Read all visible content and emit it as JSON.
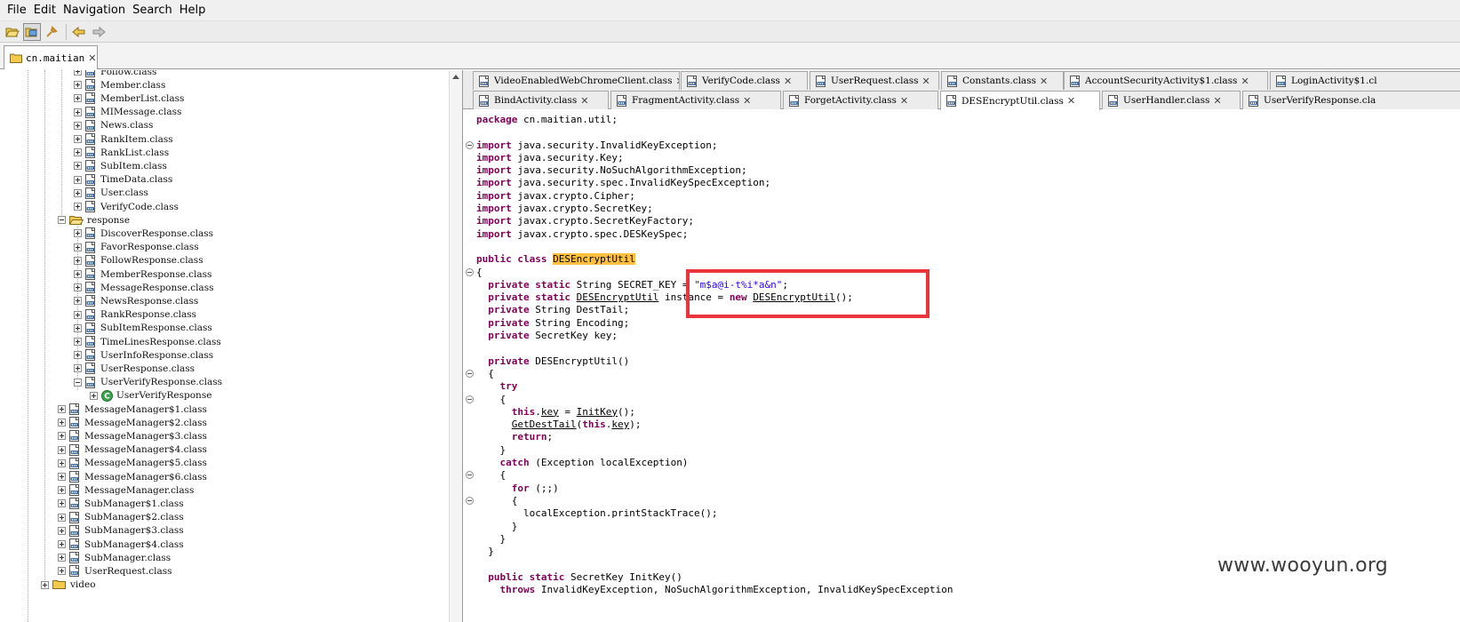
{
  "menu": {
    "items": [
      "File",
      "Edit",
      "Navigation",
      "Search",
      "Help"
    ]
  },
  "toolbar": {
    "buttons": [
      "open-file-icon",
      "open-project-icon",
      "sync-icon",
      "back-icon",
      "forward-icon"
    ]
  },
  "project_tab": {
    "label": "cn.maitian",
    "close": "✕"
  },
  "tree": {
    "rows": [
      {
        "label": "Follow.class",
        "kind": "class"
      },
      {
        "label": "Member.class",
        "kind": "class"
      },
      {
        "label": "MemberList.class",
        "kind": "class"
      },
      {
        "label": "MIMessage.class",
        "kind": "class"
      },
      {
        "label": "News.class",
        "kind": "class"
      },
      {
        "label": "RankItem.class",
        "kind": "class"
      },
      {
        "label": "RankList.class",
        "kind": "class"
      },
      {
        "label": "SubItem.class",
        "kind": "class"
      },
      {
        "label": "TimeData.class",
        "kind": "class"
      },
      {
        "label": "User.class",
        "kind": "class"
      },
      {
        "label": "VerifyCode.class",
        "kind": "class"
      },
      {
        "label": "response",
        "kind": "folder-open"
      },
      {
        "label": "DiscoverResponse.class",
        "kind": "class"
      },
      {
        "label": "FavorResponse.class",
        "kind": "class"
      },
      {
        "label": "FollowResponse.class",
        "kind": "class"
      },
      {
        "label": "MemberResponse.class",
        "kind": "class"
      },
      {
        "label": "MessageResponse.class",
        "kind": "class"
      },
      {
        "label": "NewsResponse.class",
        "kind": "class"
      },
      {
        "label": "RankResponse.class",
        "kind": "class"
      },
      {
        "label": "SubItemResponse.class",
        "kind": "class"
      },
      {
        "label": "TimeLinesResponse.class",
        "kind": "class"
      },
      {
        "label": "UserInfoResponse.class",
        "kind": "class"
      },
      {
        "label": "UserResponse.class",
        "kind": "class"
      },
      {
        "label": "UserVerifyResponse.class",
        "kind": "class-open"
      },
      {
        "label": "UserVerifyResponse",
        "kind": "type"
      },
      {
        "label": "MessageManager$1.class",
        "kind": "class"
      },
      {
        "label": "MessageManager$2.class",
        "kind": "class"
      },
      {
        "label": "MessageManager$3.class",
        "kind": "class"
      },
      {
        "label": "MessageManager$4.class",
        "kind": "class"
      },
      {
        "label": "MessageManager$5.class",
        "kind": "class"
      },
      {
        "label": "MessageManager$6.class",
        "kind": "class"
      },
      {
        "label": "MessageManager.class",
        "kind": "class"
      },
      {
        "label": "SubManager$1.class",
        "kind": "class"
      },
      {
        "label": "SubManager$2.class",
        "kind": "class"
      },
      {
        "label": "SubManager$3.class",
        "kind": "class"
      },
      {
        "label": "SubManager$4.class",
        "kind": "class"
      },
      {
        "label": "SubManager.class",
        "kind": "class"
      },
      {
        "label": "UserRequest.class",
        "kind": "class"
      },
      {
        "label": "video",
        "kind": "folder"
      }
    ]
  },
  "editor_tabs": {
    "row1": [
      {
        "label": "VideoEnabledWebChromeClient.class"
      },
      {
        "label": "VerifyCode.class"
      },
      {
        "label": "UserRequest.class"
      },
      {
        "label": "Constants.class"
      },
      {
        "label": "AccountSecurityActivity$1.class"
      },
      {
        "label": "LoginActivity$1.cl"
      }
    ],
    "row2": [
      {
        "label": "BindActivity.class"
      },
      {
        "label": "FragmentActivity.class"
      },
      {
        "label": "ForgetActivity.class"
      },
      {
        "label": "DESEncryptUtil.class",
        "active": true
      },
      {
        "label": "UserHandler.class"
      },
      {
        "label": "UserVerifyResponse.cla"
      }
    ],
    "close": "✕"
  },
  "code": {
    "lines": [
      [
        {
          "t": "package",
          "c": "kw"
        },
        {
          "t": " cn.maitian.util;"
        }
      ],
      [],
      [
        {
          "t": "import",
          "c": "kw"
        },
        {
          "t": " java.security.InvalidKeyException;"
        }
      ],
      [
        {
          "t": "import",
          "c": "kw"
        },
        {
          "t": " java.security.Key;"
        }
      ],
      [
        {
          "t": "import",
          "c": "kw"
        },
        {
          "t": " java.security.NoSuchAlgorithmException;"
        }
      ],
      [
        {
          "t": "import",
          "c": "kw"
        },
        {
          "t": " java.security.spec.InvalidKeySpecException;"
        }
      ],
      [
        {
          "t": "import",
          "c": "kw"
        },
        {
          "t": " javax.crypto.Cipher;"
        }
      ],
      [
        {
          "t": "import",
          "c": "kw"
        },
        {
          "t": " javax.crypto.SecretKey;"
        }
      ],
      [
        {
          "t": "import",
          "c": "kw"
        },
        {
          "t": " javax.crypto.SecretKeyFactory;"
        }
      ],
      [
        {
          "t": "import",
          "c": "kw"
        },
        {
          "t": " javax.crypto.spec.DESKeySpec;"
        }
      ],
      [],
      [
        {
          "t": "public",
          "c": "kw"
        },
        {
          "t": " "
        },
        {
          "t": "class",
          "c": "kw"
        },
        {
          "t": " "
        },
        {
          "t": "DESEncryptUtil",
          "c": "hl"
        }
      ],
      [
        {
          "t": "{"
        }
      ],
      [
        {
          "t": "  "
        },
        {
          "t": "private",
          "c": "kw"
        },
        {
          "t": " "
        },
        {
          "t": "static",
          "c": "kw"
        },
        {
          "t": " String SECRET_KEY = "
        },
        {
          "t": "\"m$a@i-t%i*a&n\"",
          "c": "str"
        },
        {
          "t": ";"
        }
      ],
      [
        {
          "t": "  "
        },
        {
          "t": "private",
          "c": "kw"
        },
        {
          "t": " "
        },
        {
          "t": "static",
          "c": "kw"
        },
        {
          "t": " "
        },
        {
          "t": "DESEncryptUtil",
          "c": "ul"
        },
        {
          "t": " instance = "
        },
        {
          "t": "new",
          "c": "kw"
        },
        {
          "t": " "
        },
        {
          "t": "DESEncryptUtil",
          "c": "ul"
        },
        {
          "t": "();"
        }
      ],
      [
        {
          "t": "  "
        },
        {
          "t": "private",
          "c": "kw"
        },
        {
          "t": " String DestTail;"
        }
      ],
      [
        {
          "t": "  "
        },
        {
          "t": "private",
          "c": "kw"
        },
        {
          "t": " String Encoding;"
        }
      ],
      [
        {
          "t": "  "
        },
        {
          "t": "private",
          "c": "kw"
        },
        {
          "t": " SecretKey key;"
        }
      ],
      [],
      [
        {
          "t": "  "
        },
        {
          "t": "private",
          "c": "kw"
        },
        {
          "t": " DESEncryptUtil()"
        }
      ],
      [
        {
          "t": "  {"
        }
      ],
      [
        {
          "t": "    "
        },
        {
          "t": "try",
          "c": "kw"
        }
      ],
      [
        {
          "t": "    {"
        }
      ],
      [
        {
          "t": "      "
        },
        {
          "t": "this",
          "c": "kw"
        },
        {
          "t": "."
        },
        {
          "t": "key",
          "c": "ul"
        },
        {
          "t": " = "
        },
        {
          "t": "InitKey",
          "c": "ul"
        },
        {
          "t": "();"
        }
      ],
      [
        {
          "t": "      "
        },
        {
          "t": "GetDestTail",
          "c": "ul"
        },
        {
          "t": "("
        },
        {
          "t": "this",
          "c": "kw"
        },
        {
          "t": "."
        },
        {
          "t": "key",
          "c": "ul"
        },
        {
          "t": ");"
        }
      ],
      [
        {
          "t": "      "
        },
        {
          "t": "return",
          "c": "kw"
        },
        {
          "t": ";"
        }
      ],
      [
        {
          "t": "    }"
        }
      ],
      [
        {
          "t": "    "
        },
        {
          "t": "catch",
          "c": "kw"
        },
        {
          "t": " (Exception localException)"
        }
      ],
      [
        {
          "t": "    {"
        }
      ],
      [
        {
          "t": "      "
        },
        {
          "t": "for",
          "c": "kw"
        },
        {
          "t": " (;;)"
        }
      ],
      [
        {
          "t": "      {"
        }
      ],
      [
        {
          "t": "        localException.printStackTrace();"
        }
      ],
      [
        {
          "t": "      }"
        }
      ],
      [
        {
          "t": "    }"
        }
      ],
      [
        {
          "t": "  }"
        }
      ],
      [],
      [
        {
          "t": "  "
        },
        {
          "t": "public",
          "c": "kw"
        },
        {
          "t": " "
        },
        {
          "t": "static",
          "c": "kw"
        },
        {
          "t": " SecretKey InitKey()"
        }
      ],
      [
        {
          "t": "    "
        },
        {
          "t": "throws",
          "c": "kw"
        },
        {
          "t": " InvalidKeyException, NoSuchAlgorithmException, InvalidKeySpecException"
        }
      ]
    ]
  },
  "watermark": "www.wooyun.org",
  "colors": {
    "keyword": "#7f0055",
    "string": "#2a00ff",
    "highlight": "#ffc040",
    "annotation": "#e8343a"
  }
}
